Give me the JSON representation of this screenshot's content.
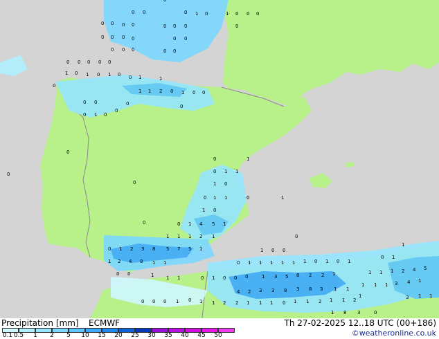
{
  "header": {
    "title": "Precipitation [mm]",
    "model": "ECMWF",
    "date": "Th 27-02-2025 12..18 UTC (00+186)",
    "credit": "©weatheronline.co.uk"
  },
  "colorbar": {
    "ticks": [
      "0.1",
      "0.5",
      "1",
      "2",
      "5",
      "10",
      "15",
      "20",
      "25",
      "30",
      "35",
      "40",
      "45",
      "50"
    ],
    "colors": [
      "#cff8ff",
      "#b0f0ff",
      "#96e6ff",
      "#7cd8ff",
      "#5ec6ff",
      "#3eaaff",
      "#2088f0",
      "#1060d8",
      "#0838b8",
      "#9a10d8",
      "#b810e0",
      "#d010e0",
      "#e818e8",
      "#f03cf0"
    ]
  },
  "map": {
    "land_color": "#b8f08a",
    "sea_color": "#d4d4d4",
    "border_color": "#8a8a8a",
    "values": [
      [
        "0",
        "0",
        "1",
        "0",
        "1",
        "0",
        "1",
        "0",
        "0",
        "0",
        "0",
        "1",
        "0",
        "0",
        "1",
        "0",
        "1",
        "0",
        "0",
        "0",
        "0",
        "0",
        "0",
        "0",
        "0",
        "0",
        "1",
        "1",
        "1",
        "1",
        "0",
        "1",
        "0",
        "0",
        "1",
        "0",
        "0",
        "1",
        "1",
        "1",
        "1",
        "1",
        "1",
        "0",
        "1",
        "1",
        "1",
        "0",
        "1",
        "1",
        "1",
        "1",
        "0",
        "0",
        "1",
        "1",
        "1",
        "1",
        "1",
        "1",
        "1",
        "0",
        "0",
        "1",
        "2",
        "1",
        "1",
        "2",
        "3",
        "0",
        "1",
        "2",
        "4",
        "8",
        "1",
        "1",
        "1",
        "1",
        "1",
        "0",
        "0",
        "1",
        "1",
        "1",
        "1",
        "1",
        "1",
        "1",
        "1",
        "2",
        "1",
        "2",
        "3",
        "3",
        "3",
        "5",
        "8",
        "3",
        "1",
        "1",
        "1",
        "2",
        "2",
        "4",
        "5"
      ]
    ]
  }
}
